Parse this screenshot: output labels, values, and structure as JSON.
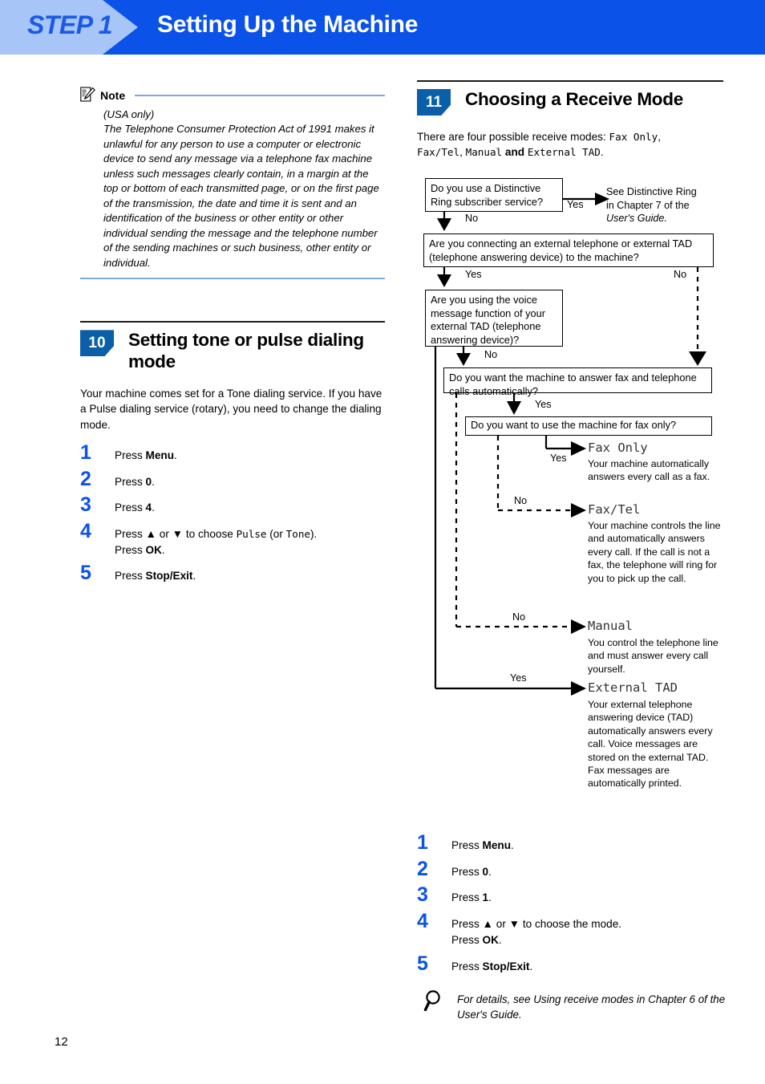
{
  "header": {
    "step_label": "STEP 1",
    "title": "Setting Up the Machine"
  },
  "note": {
    "icon": "note-pencil-icon",
    "label": "Note",
    "subtitle": "(USA only)",
    "body": "The Telephone Consumer Protection Act of 1991 makes it unlawful for any person to use a computer or electronic device to send any message via a telephone fax machine unless such messages clearly contain, in a margin at the top or bottom of each transmitted page, or on the first page of the transmission, the date and time it is sent and an identification of the business or other entity or other individual sending the message and the telephone number of the sending machines or such business, other entity or individual."
  },
  "section10": {
    "number": "10",
    "title": "Setting tone or pulse dialing mode",
    "intro": "Your machine comes set for a Tone dialing service. If you have a Pulse dialing service (rotary), you need to change the dialing mode.",
    "steps": [
      {
        "num": "1",
        "pre": "Press ",
        "bold": "Menu",
        "post": "."
      },
      {
        "num": "2",
        "pre": "Press ",
        "bold": "0",
        "post": "."
      },
      {
        "num": "3",
        "pre": "Press ",
        "bold": "4",
        "post": "."
      },
      {
        "num": "4",
        "line1_a": "Press ▲ or ▼ to choose ",
        "line1_mono1": "Pulse",
        "line1_b": " (or ",
        "line1_mono2": "Tone",
        "line1_c": ").",
        "line2_a": "Press ",
        "line2_bold": "OK",
        "line2_b": "."
      },
      {
        "num": "5",
        "pre": "Press ",
        "bold": "Stop/Exit",
        "post": "."
      }
    ]
  },
  "section11": {
    "number": "11",
    "title": "Choosing a Receive Mode",
    "intro_a": "There are four possible receive modes: ",
    "intro_mode1": "Fax Only",
    "intro_comma1": ",",
    "intro_mode2": "Fax/Tel",
    "intro_comma2": ", ",
    "intro_mode3": "Manual",
    "intro_and": " and ",
    "intro_mode4": "External TAD",
    "intro_period": ".",
    "steps": [
      {
        "num": "1",
        "pre": "Press ",
        "bold": "Menu",
        "post": "."
      },
      {
        "num": "2",
        "pre": "Press ",
        "bold": "0",
        "post": "."
      },
      {
        "num": "3",
        "pre": "Press ",
        "bold": "1",
        "post": "."
      },
      {
        "num": "4",
        "line1": "Press ▲ or ▼ to choose the mode.",
        "line2_a": "Press ",
        "line2_bold": "OK",
        "line2_b": "."
      },
      {
        "num": "5",
        "pre": "Press ",
        "bold": "Stop/Exit",
        "post": "."
      }
    ]
  },
  "flowchart": {
    "type": "decision-flowchart",
    "boxes": [
      {
        "id": "q1",
        "text": "Do you use a Distinctive Ring subscriber service?"
      },
      {
        "id": "q2",
        "text": "Are you connecting an external telephone or external TAD (telephone answering device) to the machine?"
      },
      {
        "id": "q3",
        "text": "Are you using the voice message function of your external TAD (telephone answering device)?"
      },
      {
        "id": "q4",
        "text": "Do you want the machine to answer fax and telephone calls automatically?"
      },
      {
        "id": "q5",
        "text": "Do you want to use the machine for fax only?"
      }
    ],
    "edge_labels": {
      "q1_yes": "Yes",
      "q1_no": "No",
      "q2_yes": "Yes",
      "q2_no": "No",
      "q3_no": "No",
      "q3_yes": "Yes",
      "q4_yes": "Yes",
      "q4_no": "No",
      "q5_yes": "Yes",
      "q5_no": "No"
    },
    "side_note": {
      "line1": "See Distinctive Ring",
      "line2": "in Chapter 7 of the",
      "line3": "User's Guide."
    },
    "outcomes": [
      {
        "mode": "Fax Only",
        "desc": "Your machine automatically answers every call as a fax."
      },
      {
        "mode": "Fax/Tel",
        "desc": "Your machine controls the line and automatically answers every call. If the call is not a fax, the telephone will ring for you to pick up the call."
      },
      {
        "mode": "Manual",
        "desc": "You control the telephone line and must answer every call yourself."
      },
      {
        "mode": "External TAD",
        "desc": "Your external telephone answering device (TAD) automatically answers every call. Voice messages are stored on the external TAD. Fax messages are automatically printed."
      }
    ]
  },
  "tip": {
    "icon": "magnifier-icon",
    "text": "For details, see Using receive modes in Chapter 6 of the User's Guide."
  },
  "footer": {
    "page_number": "12"
  },
  "colors": {
    "banner_blue": "#0b52e8",
    "chevron_blue": "#a8c5f7",
    "badge_blue": "#0b5ea8",
    "step_number_blue": "#0b52e8",
    "rule_blue": "#7da7e8"
  }
}
